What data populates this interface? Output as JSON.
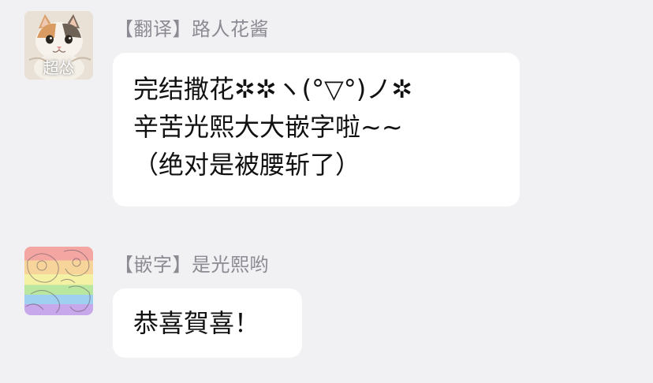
{
  "messages": [
    {
      "sender": "【翻译】路人花酱",
      "avatar_caption": "超怂",
      "avatar_icon": "cat-photo-avatar",
      "lines": [
        "完结撒花✲✲ヽ(°▽°)ノ✲",
        "辛苦光熙大大嵌字啦~~",
        "（绝对是被腰斩了）"
      ]
    },
    {
      "sender": "【嵌字】是光熙哟",
      "avatar_icon": "rainbow-avatar",
      "lines": [
        "恭喜賀喜！"
      ]
    }
  ],
  "colors": {
    "background": "#f1f1f3",
    "bubble": "#ffffff",
    "sender_text": "#8b8b93",
    "message_text": "#111111"
  }
}
